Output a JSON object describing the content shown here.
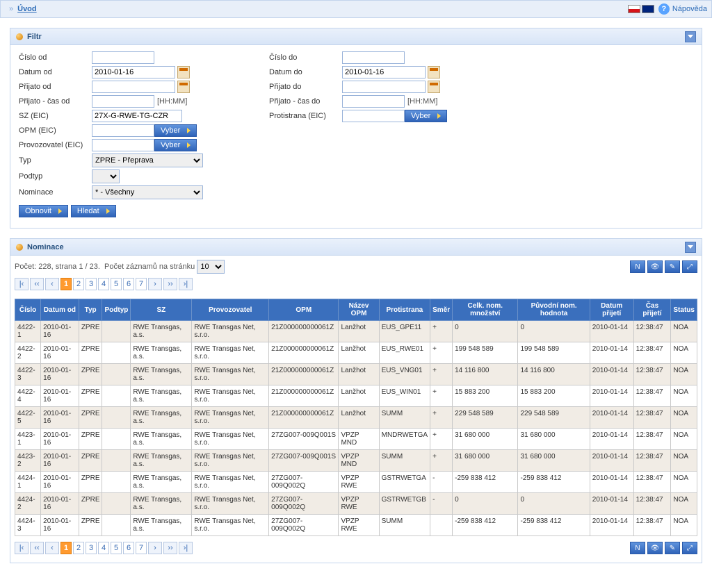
{
  "topbar": {
    "sep": "»",
    "home": "Úvod",
    "help": "Nápověda"
  },
  "filter": {
    "title": "Filtr",
    "labels": {
      "cislo_od": "Číslo od",
      "cislo_do": "Číslo do",
      "datum_od": "Datum od",
      "datum_do": "Datum do",
      "prijato_od": "Přijato od",
      "prijato_do": "Přijato do",
      "prijato_cas_od": "Přijato - čas od",
      "prijato_cas_do": "Přijato - čas do",
      "sz": "SZ (EIC)",
      "protistrana": "Protistrana (EIC)",
      "opm": "OPM (EIC)",
      "provozovatel": "Provozovatel (EIC)",
      "typ": "Typ",
      "podtyp": "Podtyp",
      "nominace": "Nominace"
    },
    "hhmm": "[HH:MM]",
    "values": {
      "datum_od": "2010-01-16",
      "datum_do": "2010-01-16",
      "sz": "27X-G-RWE-TG-CZR",
      "typ": "ZPRE - Přeprava",
      "nominace": "* - Všechny"
    },
    "buttons": {
      "vyber": "Vyber",
      "obnovit": "Obnovit",
      "hledat": "Hledat"
    }
  },
  "nom": {
    "title": "Nominace",
    "count_text": "Počet: 228, strana 1 / 23.",
    "per_page_label": "Počet záznamů na stránku",
    "per_page_value": "10",
    "pages": [
      "1",
      "2",
      "3",
      "4",
      "5",
      "6",
      "7"
    ],
    "pager_icons": {
      "first": "|‹",
      "prev2": "‹‹",
      "prev": "‹",
      "next": "›",
      "next2": "››",
      "last": "›|"
    },
    "tool_icons": {
      "i1": "N",
      "i2": "👁",
      "i3": "✎",
      "i4": "⤢"
    },
    "headers": [
      "Číslo",
      "Datum od",
      "Typ",
      "Podtyp",
      "SZ",
      "Provozovatel",
      "OPM",
      "Název OPM",
      "Protistrana",
      "Směr",
      "Celk. nom. množství",
      "Původní nom. hodnota",
      "Datum přijetí",
      "Čas přijetí",
      "Status"
    ],
    "rows": [
      [
        "4422-1",
        "2010-01-16",
        "ZPRE",
        "",
        "RWE Transgas, a.s.",
        "RWE Transgas Net, s.r.o.",
        "21Z000000000061Z",
        "Lanžhot",
        "EUS_GPE11",
        "+",
        "0",
        "0",
        "2010-01-14",
        "12:38:47",
        "NOA"
      ],
      [
        "4422-2",
        "2010-01-16",
        "ZPRE",
        "",
        "RWE Transgas, a.s.",
        "RWE Transgas Net, s.r.o.",
        "21Z000000000061Z",
        "Lanžhot",
        "EUS_RWE01",
        "+",
        "199 548 589",
        "199 548 589",
        "2010-01-14",
        "12:38:47",
        "NOA"
      ],
      [
        "4422-3",
        "2010-01-16",
        "ZPRE",
        "",
        "RWE Transgas, a.s.",
        "RWE Transgas Net, s.r.o.",
        "21Z000000000061Z",
        "Lanžhot",
        "EUS_VNG01",
        "+",
        "14 116 800",
        "14 116 800",
        "2010-01-14",
        "12:38:47",
        "NOA"
      ],
      [
        "4422-4",
        "2010-01-16",
        "ZPRE",
        "",
        "RWE Transgas, a.s.",
        "RWE Transgas Net, s.r.o.",
        "21Z000000000061Z",
        "Lanžhot",
        "EUS_WIN01",
        "+",
        "15 883 200",
        "15 883 200",
        "2010-01-14",
        "12:38:47",
        "NOA"
      ],
      [
        "4422-5",
        "2010-01-16",
        "ZPRE",
        "",
        "RWE Transgas, a.s.",
        "RWE Transgas Net, s.r.o.",
        "21Z000000000061Z",
        "Lanžhot",
        "SUMM",
        "+",
        "229 548 589",
        "229 548 589",
        "2010-01-14",
        "12:38:47",
        "NOA"
      ],
      [
        "4423-1",
        "2010-01-16",
        "ZPRE",
        "",
        "RWE Transgas, a.s.",
        "RWE Transgas Net, s.r.o.",
        "27ZG007-009Q001S",
        "VPZP MND",
        "MNDRWETGA",
        "+",
        "31 680 000",
        "31 680 000",
        "2010-01-14",
        "12:38:47",
        "NOA"
      ],
      [
        "4423-2",
        "2010-01-16",
        "ZPRE",
        "",
        "RWE Transgas, a.s.",
        "RWE Transgas Net, s.r.o.",
        "27ZG007-009Q001S",
        "VPZP MND",
        "SUMM",
        "+",
        "31 680 000",
        "31 680 000",
        "2010-01-14",
        "12:38:47",
        "NOA"
      ],
      [
        "4424-1",
        "2010-01-16",
        "ZPRE",
        "",
        "RWE Transgas, a.s.",
        "RWE Transgas Net, s.r.o.",
        "27ZG007-009Q002Q",
        "VPZP RWE",
        "GSTRWETGA",
        "-",
        "-259 838 412",
        "-259 838 412",
        "2010-01-14",
        "12:38:47",
        "NOA"
      ],
      [
        "4424-2",
        "2010-01-16",
        "ZPRE",
        "",
        "RWE Transgas, a.s.",
        "RWE Transgas Net, s.r.o.",
        "27ZG007-009Q002Q",
        "VPZP RWE",
        "GSTRWETGB",
        "-",
        "0",
        "0",
        "2010-01-14",
        "12:38:47",
        "NOA"
      ],
      [
        "4424-3",
        "2010-01-16",
        "ZPRE",
        "",
        "RWE Transgas, a.s.",
        "RWE Transgas Net, s.r.o.",
        "27ZG007-009Q002Q",
        "VPZP RWE",
        "SUMM",
        "",
        "-259 838 412",
        "-259 838 412",
        "2010-01-14",
        "12:38:47",
        "NOA"
      ]
    ]
  }
}
